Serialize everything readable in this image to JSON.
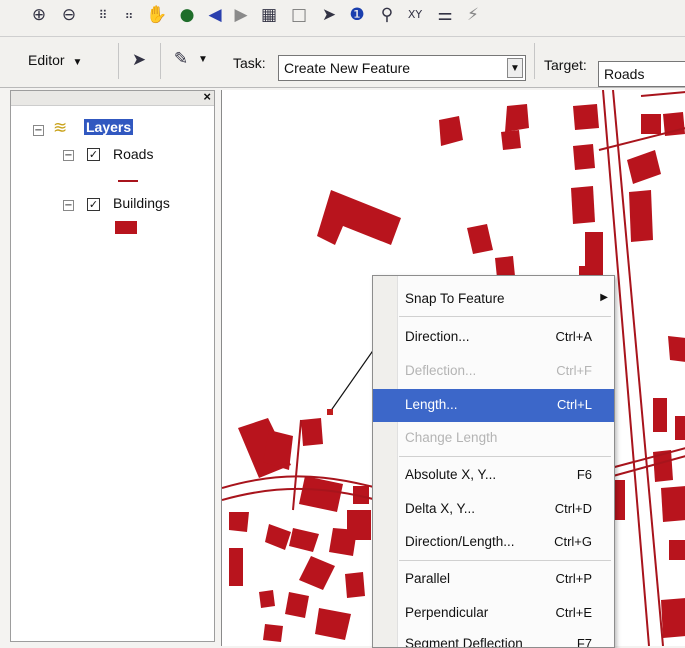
{
  "toolbar": {
    "icons": [
      "zoom-in-icon",
      "zoom-out-icon",
      "fixed-zoom-in-icon",
      "fixed-zoom-out-icon",
      "pan-icon",
      "full-extent-icon",
      "go-back-icon",
      "go-forward-icon",
      "select-features-icon",
      "clear-selection-icon",
      "select-elements-icon",
      "identify-icon",
      "find-icon",
      "go-to-xy-icon",
      "measure-icon",
      "hyperlink-icon"
    ]
  },
  "editor": {
    "menu_label": "Editor",
    "task_label": "Task:",
    "task_value": "Create New Feature",
    "target_label": "Target:",
    "target_value": "Roads"
  },
  "toc": {
    "root_label": "Layers",
    "layers": [
      {
        "name": "Roads",
        "checked": true
      },
      {
        "name": "Buildings",
        "checked": true
      }
    ]
  },
  "context_menu": {
    "items": [
      {
        "label": "Snap To Feature",
        "shortcut": "",
        "submenu": true,
        "state": "normal"
      },
      {
        "label": "Direction...",
        "shortcut": "Ctrl+A",
        "state": "normal"
      },
      {
        "label": "Deflection...",
        "shortcut": "Ctrl+F",
        "state": "disabled"
      },
      {
        "label": "Length...",
        "shortcut": "Ctrl+L",
        "state": "selected"
      },
      {
        "label": "Change Length",
        "shortcut": "",
        "state": "disabled"
      },
      {
        "label": "Absolute X, Y...",
        "shortcut": "F6",
        "state": "normal"
      },
      {
        "label": "Delta X, Y...",
        "shortcut": "Ctrl+D",
        "state": "normal"
      },
      {
        "label": "Direction/Length...",
        "shortcut": "Ctrl+G",
        "state": "normal"
      },
      {
        "label": "Parallel",
        "shortcut": "Ctrl+P",
        "state": "normal"
      },
      {
        "label": "Perpendicular",
        "shortcut": "Ctrl+E",
        "state": "normal"
      },
      {
        "label": "Segment Deflection",
        "shortcut": "F7",
        "state": "normal"
      }
    ]
  },
  "colors": {
    "building_fill": "#b8141d",
    "road_line": "#a8141c",
    "selection": "#3c67c9"
  }
}
